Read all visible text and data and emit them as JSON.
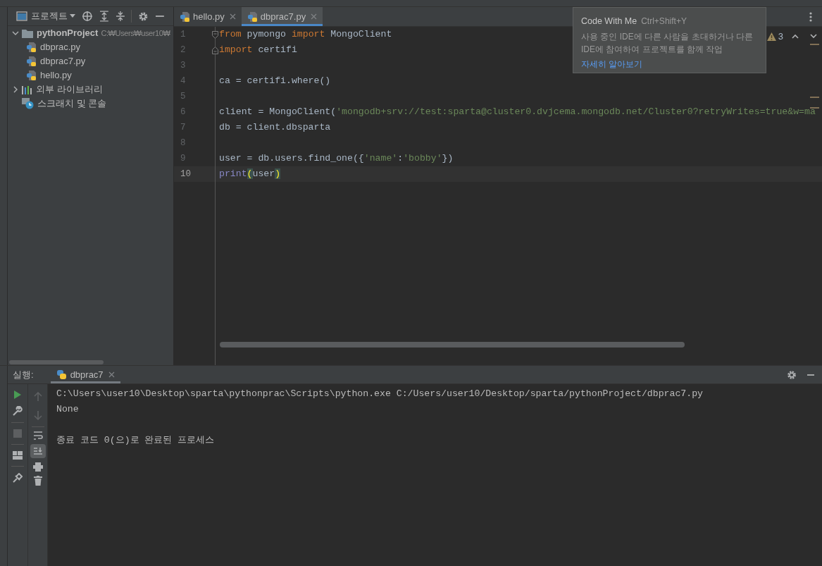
{
  "project_panel": {
    "title": "프로젝트",
    "tree": [
      {
        "label": "pythonProject",
        "path": "C:₩Users₩user10₩",
        "kind": "folder",
        "expanded": true,
        "children": [
          {
            "label": "dbprac.py",
            "kind": "python"
          },
          {
            "label": "dbprac7.py",
            "kind": "python"
          },
          {
            "label": "hello.py",
            "kind": "python"
          }
        ]
      },
      {
        "label": "외부 라이브러리",
        "kind": "library",
        "expanded": false
      },
      {
        "label": "스크래치 및 콘솔",
        "kind": "scratch"
      }
    ]
  },
  "editor": {
    "tabs": [
      {
        "label": "hello.py",
        "selected": false
      },
      {
        "label": "dbprac7.py",
        "selected": true
      }
    ],
    "warnings": "3",
    "lines": [
      {
        "number": "1",
        "fold": true,
        "current": false,
        "tokens": [
          {
            "kind": "keyword",
            "text": "from"
          },
          {
            "kind": "plain",
            "text": " pymongo "
          },
          {
            "kind": "keyword",
            "text": "import"
          },
          {
            "kind": "plain",
            "text": " MongoClient"
          }
        ]
      },
      {
        "number": "2",
        "fold": true,
        "current": false,
        "tokens": [
          {
            "kind": "keyword",
            "text": "import"
          },
          {
            "kind": "plain",
            "text": " certifi"
          }
        ]
      },
      {
        "number": "3",
        "fold": false,
        "current": false
      },
      {
        "number": "4",
        "fold": false,
        "current": false,
        "tokens": [
          {
            "kind": "plain",
            "text": "ca = certifi.where()"
          }
        ]
      },
      {
        "number": "5",
        "fold": false,
        "current": false
      },
      {
        "number": "6",
        "fold": false,
        "current": false,
        "tokens": [
          {
            "kind": "plain",
            "text": "client = MongoClient("
          },
          {
            "kind": "string",
            "text": "'mongodb+srv://test:sparta@cluster0.dvjcema.mongodb.net/Cluster0?retryWrites=true&w=ma"
          }
        ]
      },
      {
        "number": "7",
        "fold": false,
        "current": false,
        "tokens": [
          {
            "kind": "plain",
            "text": "db = client.dbsparta"
          }
        ]
      },
      {
        "number": "8",
        "fold": false,
        "current": false
      },
      {
        "number": "9",
        "fold": false,
        "current": false,
        "tokens": [
          {
            "kind": "plain",
            "text": "user = db.users.find_one({"
          },
          {
            "kind": "string",
            "text": "'name'"
          },
          {
            "kind": "plain",
            "text": ":"
          },
          {
            "kind": "string",
            "text": "'bobby'"
          },
          {
            "kind": "plain",
            "text": "})"
          }
        ]
      },
      {
        "number": "10",
        "fold": false,
        "current": true,
        "tokens": [
          {
            "kind": "builtin",
            "text": "print"
          },
          {
            "kind": "match",
            "text": "("
          },
          {
            "kind": "plain",
            "text": "user"
          },
          {
            "kind": "match",
            "text": ")"
          }
        ]
      }
    ]
  },
  "tooltip": {
    "title": "Code With Me",
    "shortcut": "Ctrl+Shift+Y",
    "description": "사용 중인 IDE에 다른 사람을 초대하거나 다른 IDE에 참여하여 프로젝트를 함께 작업",
    "link": "자세히 알아보기"
  },
  "run_panel": {
    "label": "실행:",
    "tabs": [
      {
        "label": "dbprac7",
        "selected": true
      }
    ],
    "console_blocks": [
      {
        "lines": [
          "C:\\Users\\user10\\Desktop\\sparta\\pythonprac\\Scripts\\python.exe C:/Users/user10/Desktop/sparta/pythonProject/dbprac7.py",
          "None"
        ]
      },
      {
        "lines": [
          "종료 코드 0(으)로 완료된 프로세스"
        ]
      }
    ]
  }
}
